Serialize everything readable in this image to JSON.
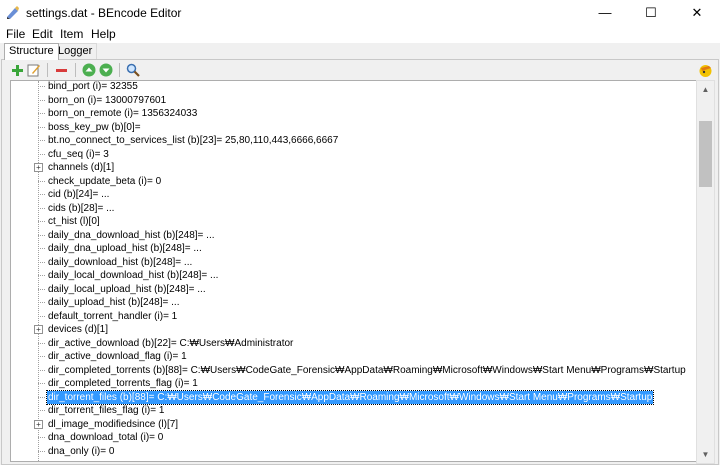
{
  "window": {
    "title": "settings.dat - BEncode Editor",
    "minimize_glyph": "—",
    "maximize_glyph": "☐",
    "close_glyph": "✕"
  },
  "menu": [
    "File",
    "Edit",
    "Item",
    "Help"
  ],
  "tabs": [
    {
      "label": "Structure",
      "active": true
    },
    {
      "label": "Logger",
      "active": false
    }
  ],
  "toolbar": {
    "icons": [
      "add-icon",
      "edit-icon",
      "delete-icon",
      "move-up-icon",
      "move-down-icon",
      "search-icon",
      "about-icon"
    ]
  },
  "tree": {
    "rows": [
      {
        "text": "bind_port (i)= 32355",
        "expandable": false
      },
      {
        "text": "born_on (i)= 13000797601",
        "expandable": false
      },
      {
        "text": "born_on_remote (i)= 1356324033",
        "expandable": false
      },
      {
        "text": "boss_key_pw (b)[0]=",
        "expandable": false
      },
      {
        "text": "bt.no_connect_to_services_list (b)[23]= 25,80,110,443,6666,6667",
        "expandable": false
      },
      {
        "text": "cfu_seq (i)= 3",
        "expandable": false
      },
      {
        "text": "channels (d)[1]",
        "expandable": true
      },
      {
        "text": "check_update_beta (i)= 0",
        "expandable": false
      },
      {
        "text": "cid (b)[24]= ...",
        "expandable": false
      },
      {
        "text": "cids (b)[28]= ...",
        "expandable": false
      },
      {
        "text": "ct_hist (l)[0]",
        "expandable": false
      },
      {
        "text": "daily_dna_download_hist (b)[248]= ...",
        "expandable": false
      },
      {
        "text": "daily_dna_upload_hist (b)[248]= ...",
        "expandable": false
      },
      {
        "text": "daily_download_hist (b)[248]= ...",
        "expandable": false
      },
      {
        "text": "daily_local_download_hist (b)[248]= ...",
        "expandable": false
      },
      {
        "text": "daily_local_upload_hist (b)[248]= ...",
        "expandable": false
      },
      {
        "text": "daily_upload_hist (b)[248]= ...",
        "expandable": false
      },
      {
        "text": "default_torrent_handler (i)= 1",
        "expandable": false
      },
      {
        "text": "devices (d)[1]",
        "expandable": true
      },
      {
        "text": "dir_active_download (b)[22]= C:₩Users₩Administrator",
        "expandable": false
      },
      {
        "text": "dir_active_download_flag (i)= 1",
        "expandable": false
      },
      {
        "text": "dir_completed_torrents (b)[88]= C:₩Users₩CodeGate_Forensic₩AppData₩Roaming₩Microsoft₩Windows₩Start Menu₩Programs₩Startup",
        "expandable": false
      },
      {
        "text": "dir_completed_torrents_flag (i)= 1",
        "expandable": false
      },
      {
        "text": "dir_torrent_files (b)[88]= C:₩Users₩CodeGate_Forensic₩AppData₩Roaming₩Microsoft₩Windows₩Start Menu₩Programs₩Startup",
        "expandable": false,
        "selected": true
      },
      {
        "text": "dir_torrent_files_flag (i)= 1",
        "expandable": false
      },
      {
        "text": "dl_image_modifiedsince (l)[7]",
        "expandable": true
      },
      {
        "text": "dna_download_total (i)= 0",
        "expandable": false
      },
      {
        "text": "dna_only (i)= 0",
        "expandable": false
      }
    ]
  },
  "colors": {
    "selection": "#3399ff",
    "window_bg": "#f0f0f0",
    "tree_bg": "#ffffff"
  }
}
